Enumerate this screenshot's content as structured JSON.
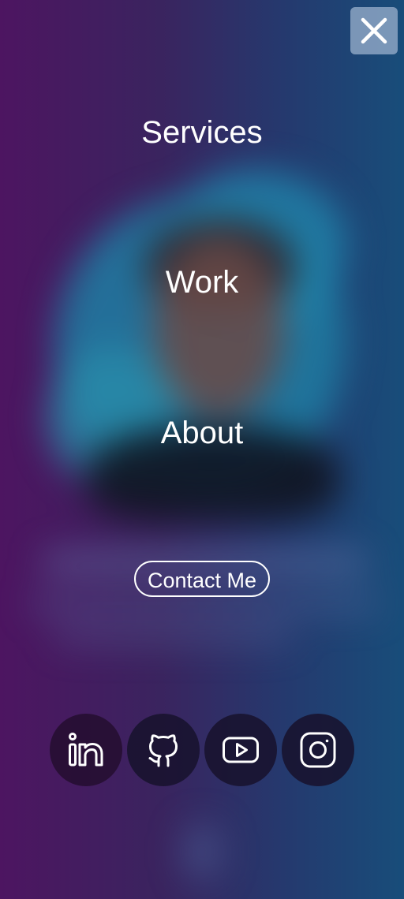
{
  "nav": {
    "items": [
      {
        "label": "Services"
      },
      {
        "label": "Work"
      },
      {
        "label": "About"
      }
    ],
    "contact_label": "Contact Me",
    "close_icon": "close-icon"
  },
  "socials": [
    {
      "name": "linkedin",
      "icon": "linkedin-icon"
    },
    {
      "name": "github",
      "icon": "github-icon"
    },
    {
      "name": "youtube",
      "icon": "youtube-icon"
    },
    {
      "name": "instagram",
      "icon": "instagram-icon"
    }
  ],
  "colors": {
    "gradient_left": "#4d1561",
    "gradient_right": "#184d7a",
    "text": "#ffffff",
    "close_button_bg": "#8ca5c3",
    "social_bg": "#18122d"
  }
}
